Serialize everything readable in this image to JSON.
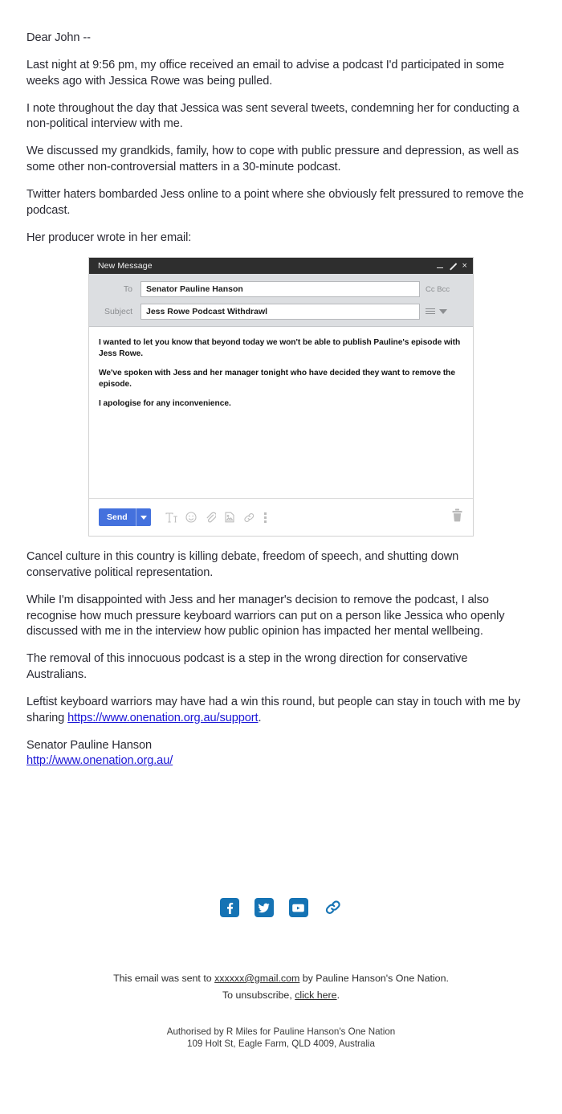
{
  "letter": {
    "paragraphs": [
      "Dear John --",
      "Last night at 9:56 pm, my office received an email to advise a podcast I'd participated in some weeks ago with Jessica Rowe was being pulled.",
      "I note throughout the day that Jessica was sent several tweets, condemning her for conducting a non-political interview with me.",
      "We discussed my grandkids, family, how to cope with public pressure and depression, as well as some other non-controversial matters in a 30-minute podcast.",
      "Twitter haters bombarded Jess online to a point where she obviously felt pressured to remove the podcast.",
      "Her producer wrote in her email:"
    ],
    "after_image": [
      "Cancel culture in this country is killing debate, freedom of speech, and shutting down conservative political representation.",
      "While I'm disappointed with Jess and her manager's decision to remove the podcast, I also recognise how much pressure keyboard warriors can put on a person like Jessica who openly discussed with me in the interview how public opinion has impacted her mental wellbeing.",
      "The removal of this innocuous podcast is a step in the wrong direction for conservative Australians."
    ],
    "closing_paragraph_prefix": "Leftist keyboard warriors may have had a win this round, but people can stay in touch with me by sharing ",
    "closing_link": "https://www.onenation.org.au/support",
    "closing_paragraph_suffix": ".",
    "signature_name": "Senator Pauline Hanson",
    "signature_link": "http://www.onenation.org.au/"
  },
  "compose": {
    "window_title": "New Message",
    "minimize_label": "minimize",
    "expand_label": "expand",
    "close_label": "×",
    "to_label": "To",
    "to_value": "Senator Pauline Hanson",
    "subject_label": "Subject",
    "subject_value": "Jess Rowe Podcast Withdrawl",
    "cc_bcc_label": "Cc Bcc",
    "body_paragraphs": [
      "I wanted to let you know that beyond today we won't be able to publish Pauline's episode with Jess Rowe.",
      "We've spoken with Jess and her manager tonight who have decided they want to remove the episode.",
      "I apologise for any inconvenience."
    ],
    "send_label": "Send",
    "toolbar_icons": [
      "format-text-icon",
      "emoji-icon",
      "attach-file-icon",
      "insert-photo-icon",
      "insert-link-icon",
      "more-options-icon"
    ],
    "trash_icon": "discard-draft-icon",
    "title_bar_color": "#2e2e2e",
    "send_button_color": "#4471dd"
  },
  "social": {
    "items": [
      {
        "name": "facebook-icon",
        "label": "Facebook"
      },
      {
        "name": "twitter-icon",
        "label": "Twitter"
      },
      {
        "name": "youtube-icon",
        "label": "YouTube"
      },
      {
        "name": "website-link-icon",
        "label": "Website"
      }
    ],
    "color": "#1573b4"
  },
  "footer": {
    "sent_to_prefix": "This email was sent to ",
    "recipient_email": "xxxxxx@gmail.com",
    "sent_to_suffix": " by Pauline Hanson's One Nation.",
    "unsubscribe_prefix": "To unsubscribe, ",
    "unsubscribe_link": "click here",
    "unsubscribe_suffix": ".",
    "authorised_line": "Authorised by R Miles for Pauline Hanson's One Nation",
    "address_line": "109 Holt St, Eagle Farm, QLD 4009, Australia"
  }
}
